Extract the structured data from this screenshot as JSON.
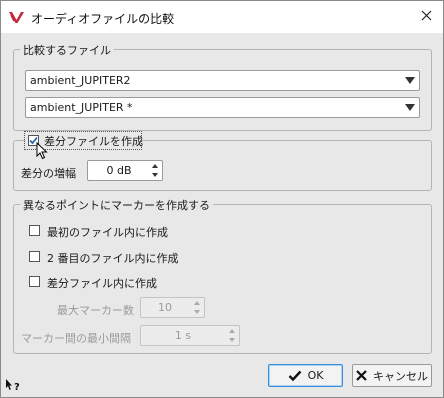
{
  "window": {
    "title": "オーディオファイルの比較"
  },
  "files_group": {
    "title": "比較するファイル",
    "file1": "ambient_JUPITER2",
    "file2": "ambient_JUPITER *"
  },
  "diff_group": {
    "checkbox_label": "差分ファイルを作成",
    "checked": true,
    "gain_label": "差分の増幅",
    "gain_value": "0 dB"
  },
  "markers_group": {
    "title": "異なるポイントにマーカーを作成する",
    "option1": "最初のファイル内に作成",
    "option2": "2 番目のファイル内に作成",
    "option3": "差分ファイル内に作成",
    "max_markers_label": "最大マーカー数",
    "max_markers_value": "10",
    "min_interval_label": "マーカー間の最小間隔",
    "min_interval_value": "1 s"
  },
  "buttons": {
    "ok": "OK",
    "cancel": "キャンセル"
  },
  "colors": {
    "accent": "#3a8fdc",
    "check": "#1e5fa8",
    "logo": "#c6243b"
  },
  "icons": [
    "app-logo-icon",
    "close-icon",
    "checkmark-icon",
    "cross-icon",
    "help-icon",
    "cursor-icon"
  ]
}
